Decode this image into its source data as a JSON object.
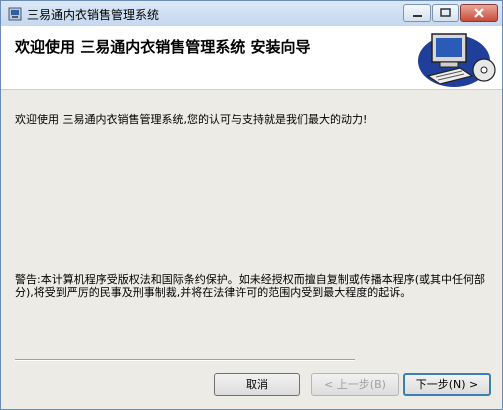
{
  "window": {
    "title": "三易通内衣销售管理系统"
  },
  "header": {
    "title": "欢迎使用  三易通内衣销售管理系统  安装向导"
  },
  "body": {
    "welcome": "欢迎使用  三易通内衣销售管理系统,您的认可与支持就是我们最大的动力!",
    "warning": "警告:本计算机程序受版权法和国际条约保护。如未经授权而擅自复制或传播本程序(或其中任何部分),将受到严厉的民事及刑事制裁,并将在法律许可的范围内受到最大程度的起诉。"
  },
  "buttons": {
    "cancel": "取消",
    "prev": "< 上一步(B)",
    "next": "下一步(N) >"
  },
  "icons": [
    "app-icon",
    "minimize-icon",
    "maximize-icon",
    "close-icon",
    "computer-cd-icon"
  ],
  "colors": {
    "title_bar": "#c4d8ef",
    "close_button": "#c94b3b",
    "dialog_bg": "#ecebe6",
    "default_button_border": "#3c7fb1"
  }
}
